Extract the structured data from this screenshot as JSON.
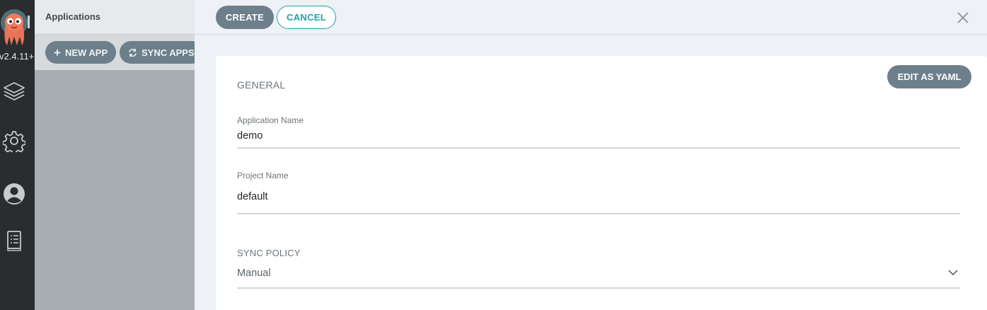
{
  "nav": {
    "version": "v2.4.11+",
    "icons": [
      "argo-logo-icon",
      "layers-icon",
      "settings-gear-icon",
      "user-icon",
      "docs-icon"
    ]
  },
  "background_page": {
    "title": "Applications",
    "new_app_label": "NEW APP",
    "sync_apps_label": "SYNC APPS"
  },
  "panel": {
    "create_label": "CREATE",
    "cancel_label": "CANCEL",
    "edit_yaml_label": "EDIT AS YAML",
    "general": {
      "title": "GENERAL",
      "application_name_label": "Application Name",
      "application_name_value": "demo",
      "project_name_label": "Project Name",
      "project_name_value": "default"
    },
    "sync_policy": {
      "title": "SYNC POLICY",
      "selected": "Manual"
    }
  },
  "colors": {
    "nav_bg": "#2a2c2e",
    "primary_button": "#6d7f8b",
    "accent_teal": "#1aa5a5",
    "panel_bg": "#eef1f5"
  }
}
